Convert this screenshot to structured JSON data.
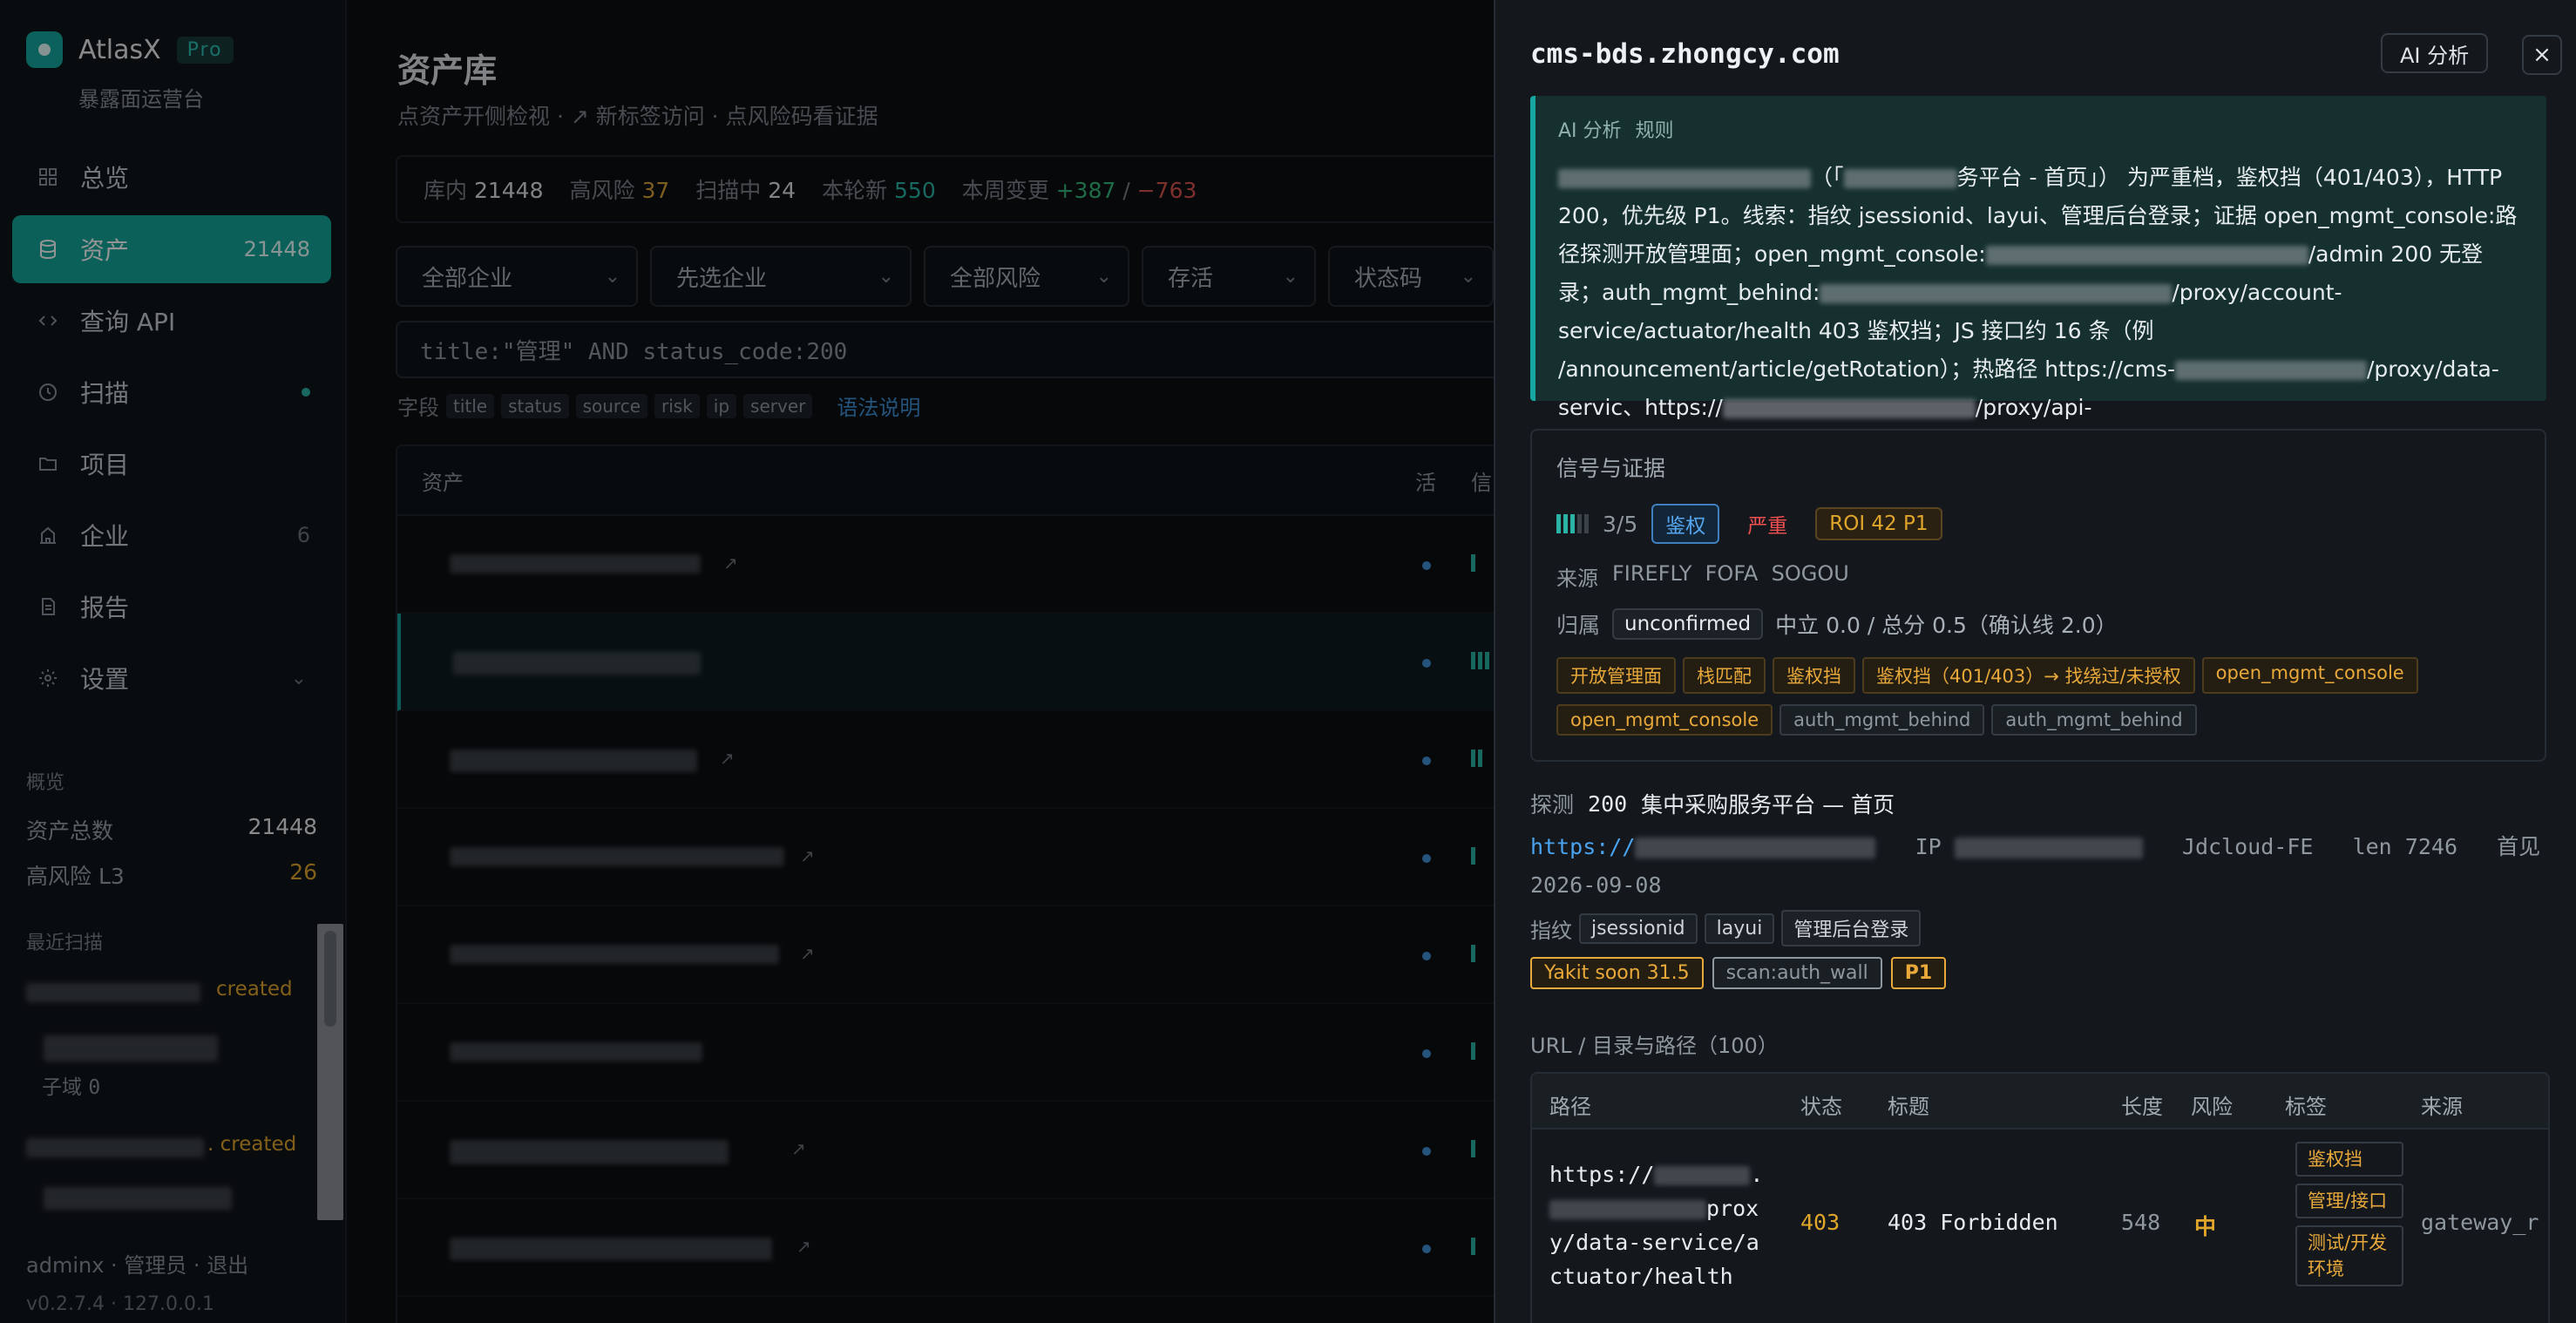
{
  "app": {
    "name": "AtlasX",
    "badge": "Pro",
    "subtitle": "暴露面运营台"
  },
  "sidebar": {
    "items": [
      {
        "label": "总览",
        "icon": "grid-icon"
      },
      {
        "label": "资产",
        "icon": "database-icon",
        "count": "21448",
        "active": true
      },
      {
        "label": "查询 API",
        "icon": "code-icon"
      },
      {
        "label": "扫描",
        "icon": "clock-icon"
      },
      {
        "label": "项目",
        "icon": "folder-icon"
      },
      {
        "label": "企业",
        "icon": "building-icon",
        "count": "6"
      },
      {
        "label": "报告",
        "icon": "document-icon"
      },
      {
        "label": "设置",
        "icon": "gear-icon"
      }
    ],
    "overview_title": "概览",
    "overview": [
      {
        "label": "资产总数",
        "value": "21448"
      },
      {
        "label": "高风险 L3",
        "value": "26"
      }
    ],
    "recent_scans_title": "最近扫描",
    "recent_scans": [
      {
        "status": "created",
        "subdomain_label": "子域",
        "subdomain_count": "0"
      },
      {
        "status": ". created"
      }
    ],
    "footer_user": "adminx",
    "footer_role": "管理员",
    "footer_logout": "退出",
    "footer_version": "v0.2.7.4 · 127.0.0.1"
  },
  "main": {
    "title": "资产库",
    "subtitle": "点资产开侧检视 · ↗ 新标签访问 · 点风险码看证据",
    "stats": {
      "in_lib_label": "库内",
      "in_lib": "21448",
      "high_label": "高风险",
      "high": "37",
      "scanning_label": "扫描中",
      "scanning": "24",
      "new_label": "本轮新",
      "new": "550",
      "weekly_label": "本周变更",
      "weekly_add": "+387",
      "weekly_sep": "/",
      "weekly_del": "−763"
    },
    "filters": [
      "全部企业",
      "先选企业",
      "全部风险",
      "存活",
      "状态码"
    ],
    "query": "title:\"管理\" AND status_code:200",
    "fields_label": "字段",
    "fields": [
      "title",
      "status",
      "source",
      "risk",
      "ip",
      "server"
    ],
    "syntax_help": "语法说明",
    "table_headers": [
      "资产",
      "活",
      "信"
    ]
  },
  "panel": {
    "title": "cms-bds.zhongcy.com",
    "ai_button": "AI 分析",
    "close": "×",
    "ai_box": {
      "head_label": "AI 分析",
      "head_mode": "规则",
      "text_1": "（「",
      "text_2": "务平台 - 首页」） 为严重档，鉴权挡（401/403），HTTP 200，优先级 P1。线索：指纹 jsessionid、layui、管理后台登录；证据 open_mgmt_console:路径探测开放管理面；open_mgmt_console:",
      "text_3": "/admin 200 无登录；auth_mgmt_behind:",
      "text_4": "/proxy/account-service/actuator/health 403 鉴权挡；JS 接口约 16 条（例 /announcement/article/getRotation）；热路径 https://cms-",
      "text_5": "/proxy/data-servic、https://",
      "text_6": "/proxy/api-"
    },
    "signals": {
      "title": "信号与证据",
      "score": "3/5",
      "badge_auth": "鉴权",
      "badge_severity": "严重",
      "badge_roi": "ROI 42 P1",
      "source_label": "来源",
      "sources": "FIREFLY  FOFA  SOGOU",
      "owner_label": "归属",
      "owner_value": "unconfirmed",
      "owner_text": "中立 0.0 / 总分 0.5（确认线 2.0）",
      "chips": [
        {
          "label": "开放管理面",
          "tone": "orange"
        },
        {
          "label": "栈匹配",
          "tone": "orange"
        },
        {
          "label": "鉴权挡",
          "tone": "orange"
        },
        {
          "label": "鉴权挡（401/403）→ 找绕过/未授权",
          "tone": "orange"
        },
        {
          "label": "open_mgmt_console",
          "tone": "orange"
        },
        {
          "label": "open_mgmt_console",
          "tone": "orange"
        },
        {
          "label": "auth_mgmt_behind",
          "tone": "gray"
        },
        {
          "label": "auth_mgmt_behind",
          "tone": "gray"
        }
      ]
    },
    "probe": {
      "label": "探测",
      "code": "200",
      "title": "集中采购服务平台 — 首页",
      "url_prefix": "https://",
      "ip_label": "IP",
      "server": "Jdcloud-FE",
      "len_label": "len",
      "len": "7246",
      "first_label": "首见",
      "first_seen": "2026-09-08",
      "fp_label": "指纹",
      "fingerprints": [
        "jsessionid",
        "layui",
        "管理后台登录"
      ],
      "tags": [
        {
          "label": "Yakit soon 31.5",
          "tone": "orange"
        },
        {
          "label": "scan:auth_wall",
          "tone": "gray"
        },
        {
          "label": "P1",
          "tone": "orange"
        }
      ]
    },
    "urls": {
      "title": "URL / 目录与路径（100）",
      "headers": [
        "路径",
        "状态",
        "标题",
        "长度",
        "风险",
        "标签",
        "来源"
      ],
      "rows": [
        {
          "path_1": "https://",
          "path_2": "prox",
          "path_3": "y/data-service/a",
          "path_4": "ctuator/health",
          "status": "403",
          "title": "403 Forbidden",
          "length": "548",
          "risk": "中",
          "tags": [
            "鉴权挡",
            "管理/接口",
            "测试/开发环境"
          ],
          "source": "gateway_r"
        }
      ]
    }
  },
  "colors": {
    "accent": "#13a79c",
    "warning": "#e0a52b",
    "danger": "#ef4f4f",
    "link": "#4aa3ee"
  }
}
